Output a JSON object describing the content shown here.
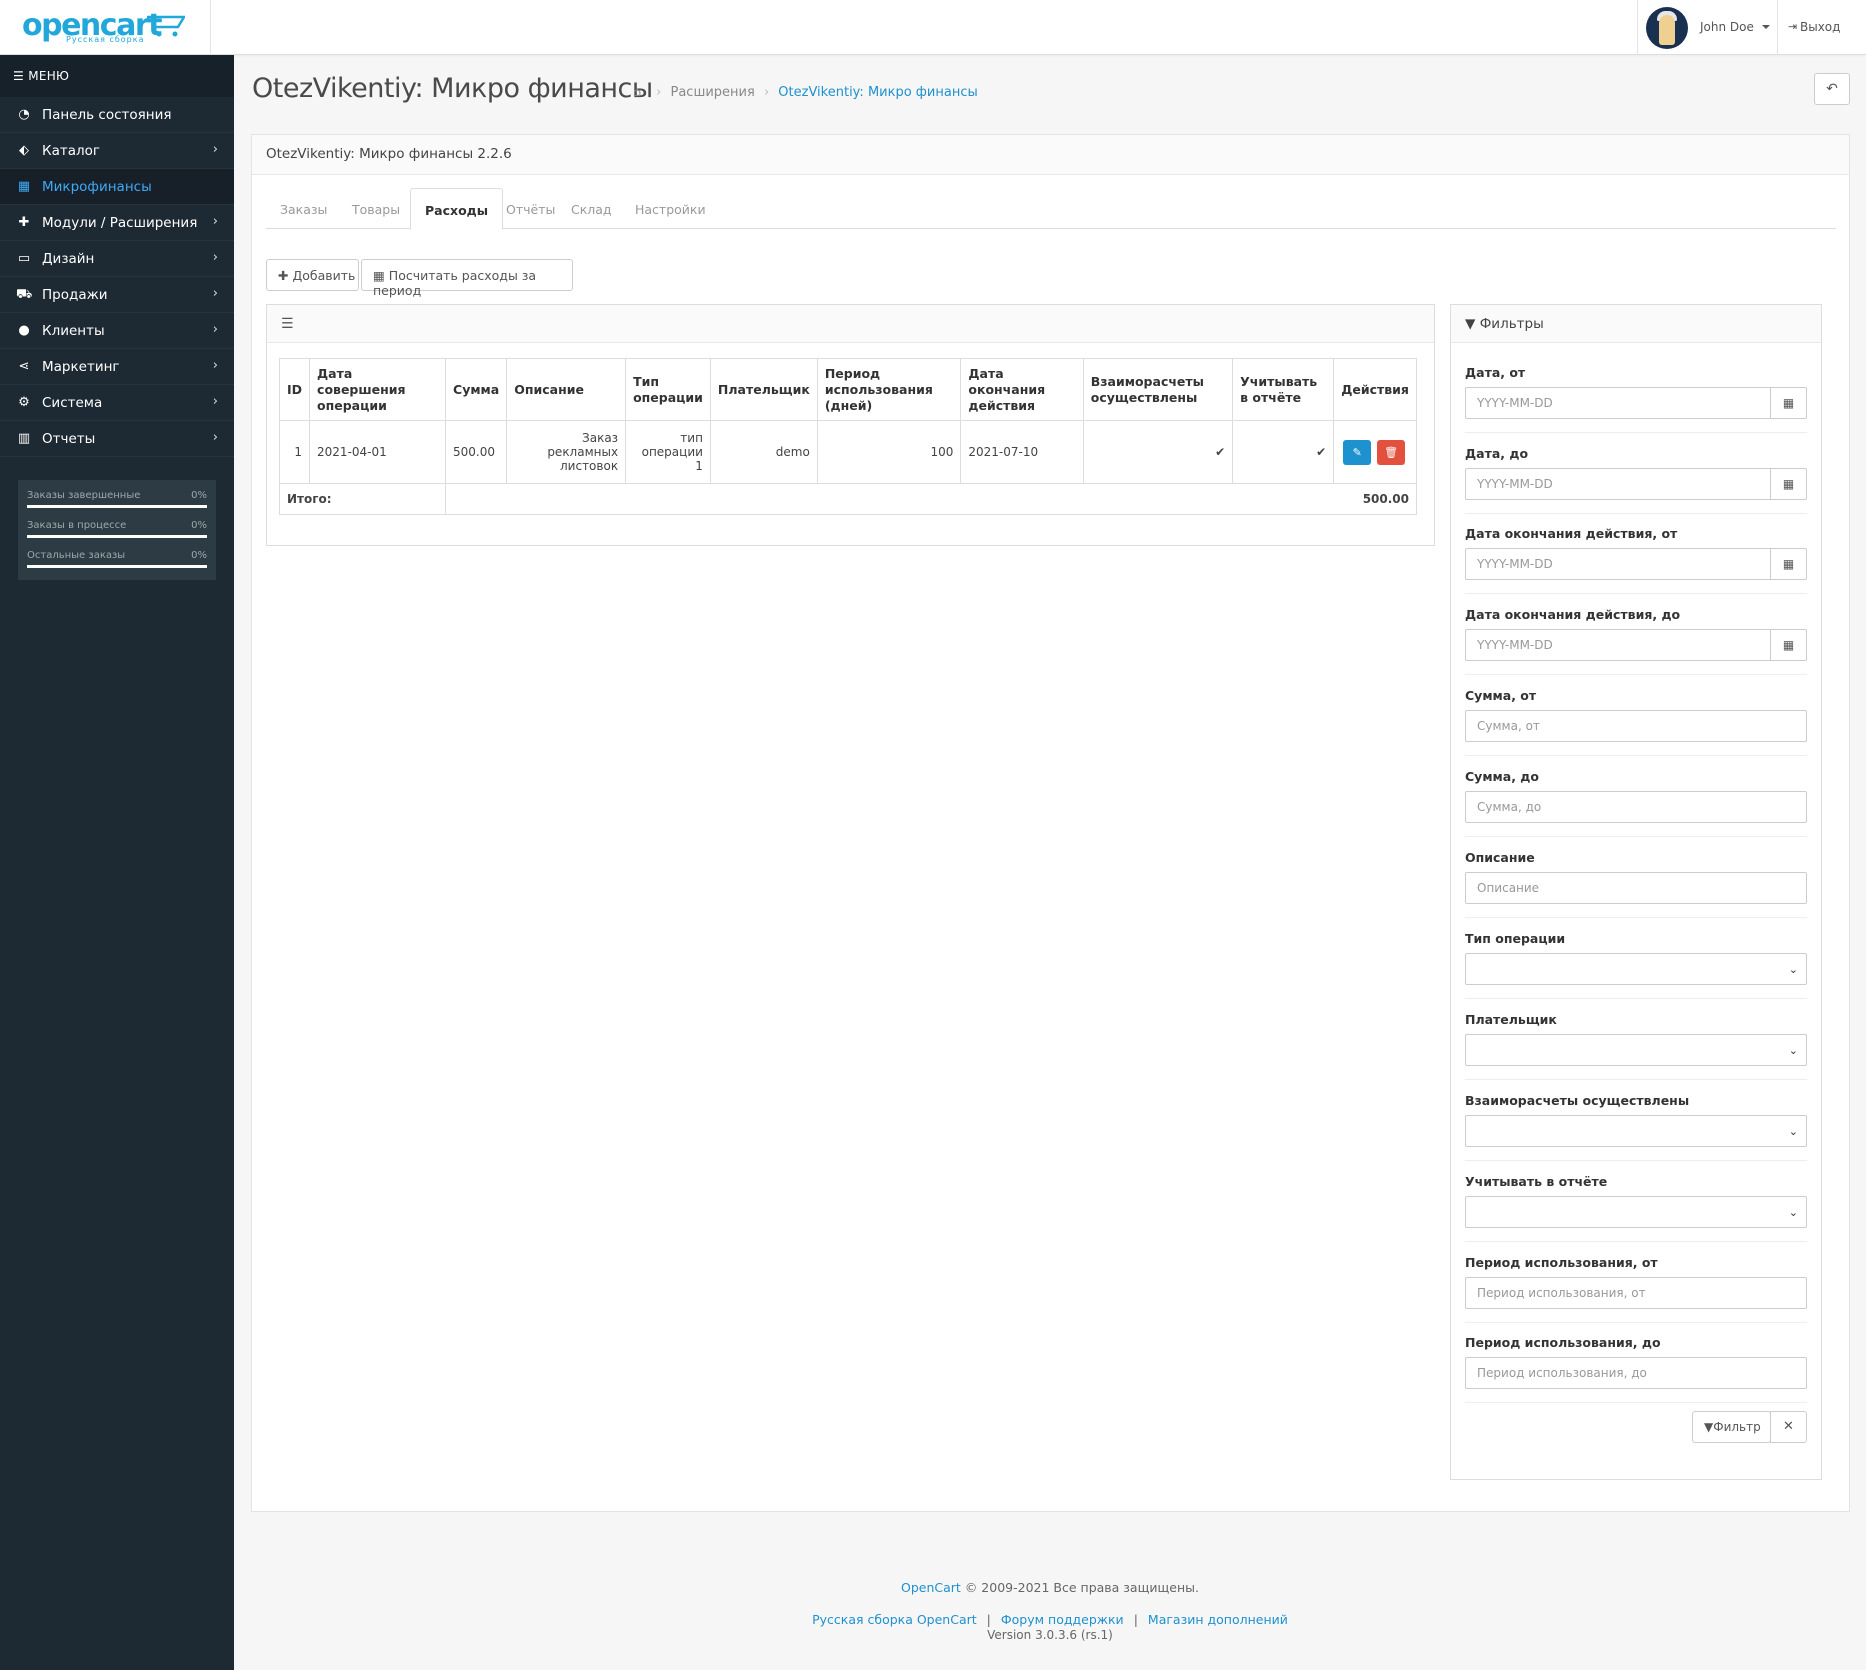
{
  "header": {
    "logo_text": "opencart",
    "logo_subtitle": "Русская сборка",
    "user_name": "John Doe",
    "logout_label": "Выход"
  },
  "sidebar": {
    "menu_title": "МЕНЮ",
    "items": [
      {
        "label": "Панель состояния",
        "icon": "dashboard-icon",
        "has_children": false
      },
      {
        "label": "Каталог",
        "icon": "tags-icon",
        "has_children": true
      },
      {
        "label": "Микрофинансы",
        "icon": "calculator-icon",
        "has_children": false,
        "active": true
      },
      {
        "label": "Модули / Расширения",
        "icon": "puzzle-icon",
        "has_children": true
      },
      {
        "label": "Дизайн",
        "icon": "monitor-icon",
        "has_children": true
      },
      {
        "label": "Продажи",
        "icon": "cart-icon",
        "has_children": true
      },
      {
        "label": "Клиенты",
        "icon": "user-icon",
        "has_children": true
      },
      {
        "label": "Маркетинг",
        "icon": "share-icon",
        "has_children": true
      },
      {
        "label": "Система",
        "icon": "gear-icon",
        "has_children": true
      },
      {
        "label": "Отчеты",
        "icon": "bar-chart-icon",
        "has_children": true
      }
    ],
    "progress": [
      {
        "label": "Заказы завершенные",
        "value": "0%"
      },
      {
        "label": "Заказы в процессе",
        "value": "0%"
      },
      {
        "label": "Остальные заказы",
        "value": "0%"
      }
    ]
  },
  "page": {
    "title": "OtezVikentiy: Микро финансы",
    "breadcrumb": {
      "extensions": "Расширения",
      "current": "OtezVikentiy: Микро финансы"
    },
    "panel_heading": "OtezVikentiy: Микро финансы 2.2.6",
    "tabs": [
      "Заказы",
      "Товары",
      "Расходы",
      "Отчёты",
      "Склад",
      "Настройки"
    ],
    "active_tab": "Расходы",
    "buttons": {
      "add": "Добавить",
      "calc": "Посчитать расходы за период"
    }
  },
  "table": {
    "headers": [
      "ID",
      "Дата совершения операции",
      "Сумма",
      "Описание",
      "Тип операции",
      "Плательщик",
      "Период использования (дней)",
      "Дата окончания действия",
      "Взаиморасчеты осуществлены",
      "Учитывать в отчёте",
      "Действия"
    ],
    "rows": [
      {
        "id": "1",
        "date": "2021-04-01",
        "sum": "500.00",
        "description": "Заказ рекламных листовок",
        "op_type": "тип операции 1",
        "payer": "demo",
        "period": "100",
        "end_date": "2021-07-10",
        "settled": true,
        "in_report": true
      }
    ],
    "total_label": "Итого:",
    "total_value": "500.00"
  },
  "filters": {
    "title": "Фильтры",
    "fields": [
      {
        "label": "Дата, от",
        "placeholder": "YYYY-MM-DD",
        "type": "date"
      },
      {
        "label": "Дата, до",
        "placeholder": "YYYY-MM-DD",
        "type": "date"
      },
      {
        "label": "Дата окончания действия, от",
        "placeholder": "YYYY-MM-DD",
        "type": "date"
      },
      {
        "label": "Дата окончания действия, до",
        "placeholder": "YYYY-MM-DD",
        "type": "date"
      },
      {
        "label": "Сумма, от",
        "placeholder": "Сумма, от",
        "type": "text"
      },
      {
        "label": "Сумма, до",
        "placeholder": "Сумма, до",
        "type": "text"
      },
      {
        "label": "Описание",
        "placeholder": "Описание",
        "type": "text"
      },
      {
        "label": "Тип операции",
        "placeholder": "",
        "type": "select"
      },
      {
        "label": "Плательщик",
        "placeholder": "",
        "type": "select"
      },
      {
        "label": "Взаиморасчеты осуществлены",
        "placeholder": "",
        "type": "select"
      },
      {
        "label": "Учитывать в отчёте",
        "placeholder": "",
        "type": "select"
      },
      {
        "label": "Период использования, от",
        "placeholder": "Период использования, от",
        "type": "text"
      },
      {
        "label": "Период использования, до",
        "placeholder": "Период использования, до",
        "type": "text"
      }
    ],
    "filter_button": "Фильтр"
  },
  "footer": {
    "brand": "OpenCart",
    "copyright": "© 2009-2021 Все права защищены.",
    "links": [
      "Русская сборка OpenCart",
      "Форум поддержки",
      "Магазин дополнений"
    ],
    "version": "Version 3.0.3.6 (rs.1)"
  },
  "colors": {
    "accent": "#1e91cf",
    "sidebar_bg": "#1e2a33",
    "edit_button": "#1e91cf",
    "delete_button": "#e3503e"
  }
}
